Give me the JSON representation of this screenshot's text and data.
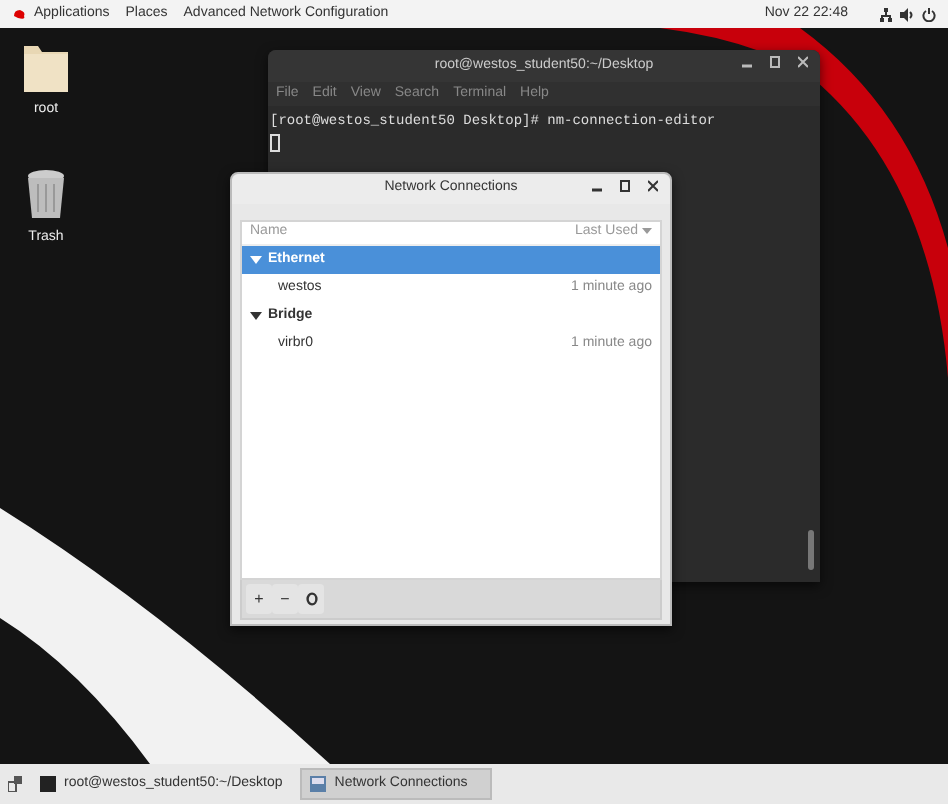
{
  "top_bar": {
    "menus": [
      "Applications",
      "Places",
      "Advanced Network Configuration"
    ],
    "clock": "Nov 22  22:48"
  },
  "desktop_icons": [
    {
      "label": "root",
      "kind": "folder"
    },
    {
      "label": "Trash",
      "kind": "trash"
    }
  ],
  "terminal": {
    "title": "root@westos_student50:~/Desktop",
    "menu": [
      "File",
      "Edit",
      "View",
      "Search",
      "Terminal",
      "Help"
    ],
    "lines": [
      "[root@westos_student50 Desktop]# nm-connection-editor"
    ]
  },
  "network_connections": {
    "title": "Network Connections",
    "columns": [
      "Name",
      "Last Used"
    ],
    "groups": [
      {
        "name": "Ethernet",
        "selected": true,
        "expanded": true,
        "children": [
          {
            "name": "westos",
            "last_used": "1 minute ago",
            "selected": false
          }
        ]
      },
      {
        "name": "Bridge",
        "selected": false,
        "expanded": true,
        "children": [
          {
            "name": "virbr0",
            "last_used": "1 minute ago",
            "selected": false
          }
        ]
      }
    ],
    "toolbar_buttons": [
      "+",
      "−"
    ]
  },
  "taskbar": [
    {
      "label": "root@westos_student50:~/Desktop",
      "kind": "terminal",
      "selected": false
    },
    {
      "label": "Network Connections",
      "kind": "network",
      "selected": true
    }
  ]
}
